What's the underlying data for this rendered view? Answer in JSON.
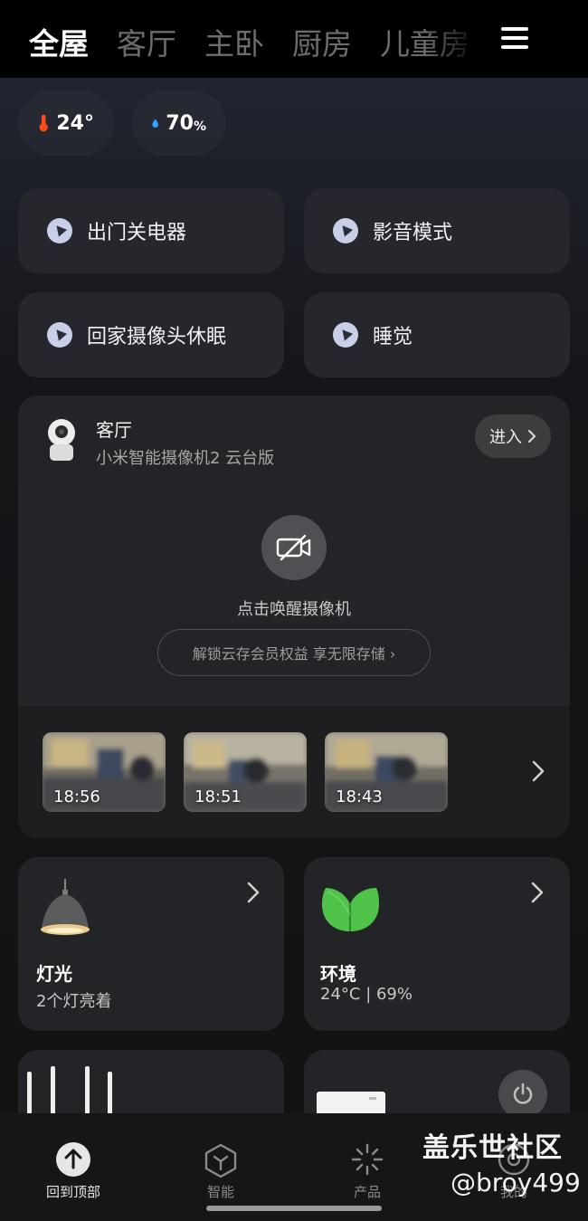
{
  "tabs": [
    {
      "label": "全屋",
      "active": true
    },
    {
      "label": "客厅",
      "active": false
    },
    {
      "label": "主卧",
      "active": false
    },
    {
      "label": "厨房",
      "active": false
    },
    {
      "label": "儿童房",
      "active": false
    }
  ],
  "env": {
    "temperature": "24°",
    "humidity_value": "70",
    "humidity_unit": "%"
  },
  "scenes": [
    {
      "label": "出门关电器"
    },
    {
      "label": "影音模式"
    },
    {
      "label": "回家摄像头休眠"
    },
    {
      "label": "睡觉"
    }
  ],
  "camera_card": {
    "room": "客厅",
    "model": "小米智能摄像机2 云台版",
    "enter_label": "进入",
    "wake_text": "点击唤醒摄像机",
    "cloud_text": "解锁云存会员权益 享无限存储 ›",
    "thumbnails": [
      {
        "time": "18:56"
      },
      {
        "time": "18:51"
      },
      {
        "time": "18:43"
      }
    ]
  },
  "device_cards": [
    {
      "title": "灯光",
      "subtitle": "2个灯亮着"
    },
    {
      "title": "环境",
      "subtitle": "24°C | 69%"
    }
  ],
  "bottom_nav": [
    {
      "label": "回到顶部",
      "active": true,
      "icon": "arrow-up-icon"
    },
    {
      "label": "智能",
      "active": false,
      "icon": "cube-icon"
    },
    {
      "label": "产品",
      "active": false,
      "icon": "sparkle-icon"
    },
    {
      "label": "我的",
      "active": false,
      "icon": "profile-icon"
    }
  ],
  "watermark": {
    "line1": "盖乐世社区",
    "line2": "@broy499"
  },
  "colors": {
    "card": "#232427",
    "scene_card": "#25272c",
    "temperature_icon": "#ff4a1c",
    "humidity_icon": "#2fa4ff",
    "leaf": "#4fc24a"
  }
}
